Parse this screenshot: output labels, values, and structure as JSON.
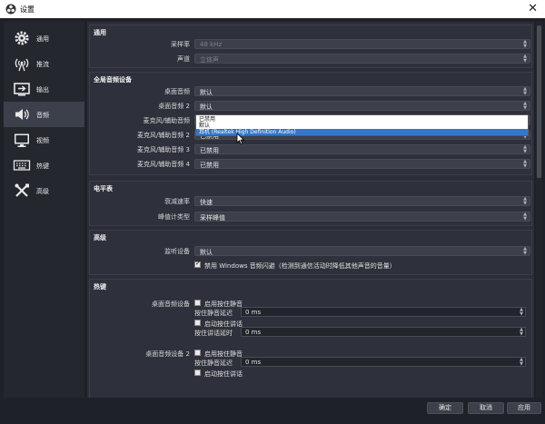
{
  "window": {
    "title": "设置",
    "close_glyph": "✕"
  },
  "sidebar": {
    "items": [
      {
        "label": "通用",
        "icon": "gear-icon"
      },
      {
        "label": "推流",
        "icon": "broadcast-icon"
      },
      {
        "label": "输出",
        "icon": "output-icon"
      },
      {
        "label": "音频",
        "icon": "speaker-icon",
        "active": true
      },
      {
        "label": "视频",
        "icon": "monitor-icon"
      },
      {
        "label": "热键",
        "icon": "keyboard-icon"
      },
      {
        "label": "高级",
        "icon": "tools-icon"
      }
    ]
  },
  "groups": {
    "general": {
      "title": "通用",
      "sample_rate_label": "采样率",
      "sample_rate_value": "48 kHz",
      "channels_label": "声道",
      "channels_value": "立体声"
    },
    "global_audio": {
      "title": "全局音频设备",
      "desktop1_label": "桌面音频",
      "desktop1_value": "默认",
      "desktop2_label": "桌面音频 2",
      "desktop2_value": "默认",
      "mic1_label": "麦克风/辅助音频",
      "mic1_value": "默认",
      "mic2_label": "麦克风/辅助音频 2",
      "mic2_value": "已禁用",
      "mic3_label": "麦克风/辅助音频 3",
      "mic3_value": "已禁用",
      "mic4_label": "麦克风/辅助音频 4",
      "mic4_value": "已禁用"
    },
    "meters": {
      "title": "电平表",
      "decay_label": "衰减速率",
      "decay_value": "快速",
      "peak_label": "峰值计类型",
      "peak_value": "采样峰值"
    },
    "advanced": {
      "title": "高级",
      "monitor_label": "监听设备",
      "monitor_value": "默认",
      "ducking_label": "禁用 Windows 音频闪避（检测到通信活动时降低其他声音的音量）"
    },
    "hotkeys": {
      "title": "热键",
      "dev1_label": "桌面音频设备",
      "dev2_label": "桌面音频设备 2",
      "enable_ptm": "启用按住静音",
      "ptm_delay": "按住静音延迟",
      "enable_ptt": "启动按住讲话",
      "ptt_delay": "按住讲话延时",
      "delay_value": "0 ms"
    }
  },
  "dropdown": {
    "options": [
      "已禁用",
      "默认",
      "耳机 (Realtek High Definition Audio)"
    ],
    "highlighted_index": 2
  },
  "buttons": {
    "ok": "确定",
    "cancel": "取消",
    "apply": "应用"
  },
  "colors": {
    "accent": "#3477c9",
    "panel": "#2e313b",
    "sidebar_active": "#3c404b"
  }
}
